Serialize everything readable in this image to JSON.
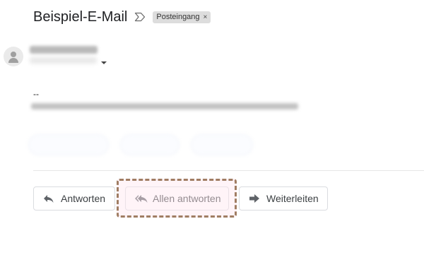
{
  "email": {
    "subject": "Beispiel-E-Mail",
    "label": "Posteingang",
    "label_remove": "×",
    "signature_separator": "--"
  },
  "icons": {
    "importance": "importance-marker-icon",
    "avatar": "default-avatar-icon",
    "details": "caret-down-icon",
    "reply": "reply-arrow-icon",
    "reply_all": "reply-all-arrow-icon",
    "forward": "forward-arrow-icon"
  },
  "actions": {
    "reply_label": "Antworten",
    "reply_all_label": "Allen antworten",
    "forward_label": "Weiterleiten"
  },
  "colors": {
    "highlight_border": "#a07d63",
    "highlight_fill": "#ffe6f0",
    "label_chip_bg": "#dddddd",
    "icon_gray": "#5f6368"
  }
}
